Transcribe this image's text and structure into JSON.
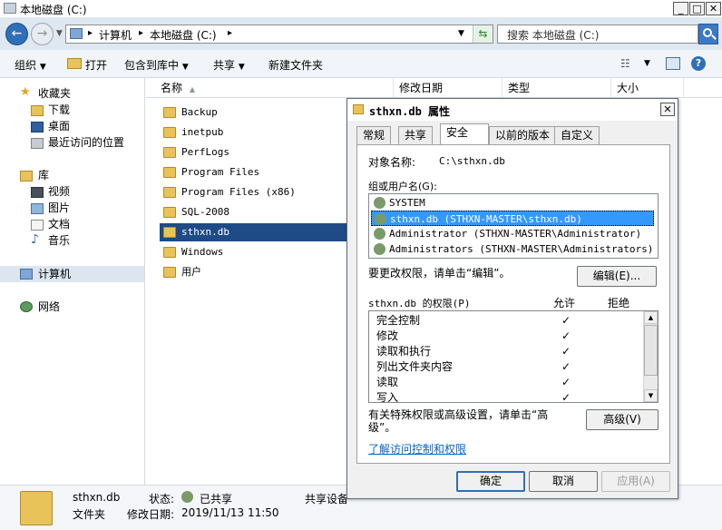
{
  "window": {
    "title": "本地磁盘 (C:)"
  },
  "address": {
    "computer": "计算机",
    "drive": "本地磁盘 (C:)",
    "search_placeholder": "搜索 本地磁盘 (C:)"
  },
  "toolbar": {
    "organize": "组织",
    "open": "打开",
    "include_library": "包含到库中",
    "share": "共享",
    "new_folder": "新建文件夹"
  },
  "nav": {
    "favorites": "收藏夹",
    "downloads": "下载",
    "desktop": "桌面",
    "recent": "最近访问的位置",
    "libraries": "库",
    "videos": "视频",
    "pictures": "图片",
    "documents": "文档",
    "music": "音乐",
    "computer": "计算机",
    "network": "网络"
  },
  "columns": {
    "name": "名称",
    "modified": "修改日期",
    "type": "类型",
    "size": "大小"
  },
  "files": [
    "Backup",
    "inetpub",
    "PerfLogs",
    "Program Files",
    "Program Files (x86)",
    "SQL-2008",
    "sthxn.db",
    "Windows",
    "用户"
  ],
  "selected_file": "sthxn.db",
  "status": {
    "name": "sthxn.db",
    "kind": "文件夹",
    "state_label": "状态:",
    "state_value": "已共享",
    "modified_label": "修改日期:",
    "modified_value": "2019/11/13 11:50",
    "shared_label": "共享设备"
  },
  "dialog": {
    "title": "sthxn.db 属性",
    "tabs": [
      "常规",
      "共享",
      "安全",
      "以前的版本",
      "自定义"
    ],
    "active_tab": "安全",
    "object_label": "对象名称:",
    "object_value": "C:\\sthxn.db",
    "group_label": "组或用户名(G):",
    "users": [
      "SYSTEM",
      "sthxn.db (STHXN-MASTER\\sthxn.db)",
      "Administrator (STHXN-MASTER\\Administrator)",
      "Administrators (STHXN-MASTER\\Administrators)"
    ],
    "change_perm_text": "要更改权限，请单击“编辑”。",
    "edit_button": "编辑(E)...",
    "perm_label": "sthxn.db 的权限(P)",
    "allow": "允许",
    "deny": "拒绝",
    "permissions": [
      "完全控制",
      "修改",
      "读取和执行",
      "列出文件夹内容",
      "读取",
      "写入"
    ],
    "check_mark": "✓",
    "special_text": "有关特殊权限或高级设置，请单击“高级”。",
    "advanced_button": "高级(V)",
    "link_text": "了解访问控制和权限",
    "ok": "确定",
    "cancel": "取消",
    "apply": "应用(A)"
  },
  "colors": {
    "accent": "#3399ff",
    "selection_row": "#1e4a86",
    "link": "#0066cc"
  }
}
